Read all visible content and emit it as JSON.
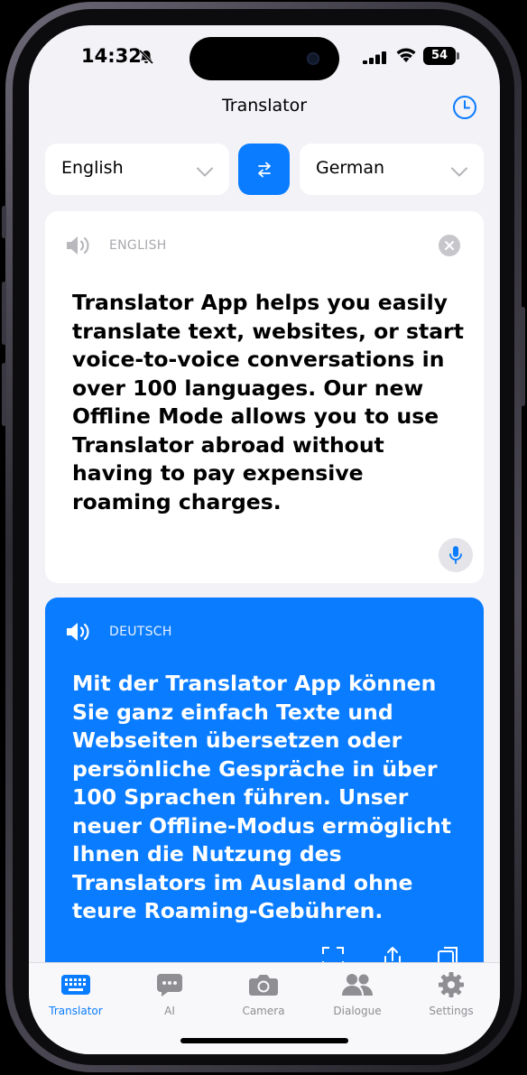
{
  "status_bar": {
    "time": "14:32",
    "battery": "54"
  },
  "header": {
    "title": "Translator"
  },
  "languages": {
    "source": "English",
    "target": "German"
  },
  "source_card": {
    "lang_tag": "ENGLISH",
    "text": "Translator App helps you easily translate text, websites, or start voice-to-voice conversations in over 100 languages. Our new Offline Mode allows you to use Translator abroad without having to pay expensive roaming charges."
  },
  "target_card": {
    "lang_tag": "DEUTSCH",
    "text": "Mit der Translator App können Sie ganz einfach Texte und Webseiten übersetzen oder persönliche Gespräche in über 100 Sprachen führen. Unser neuer Offline-Modus ermöglicht Ihnen die Nutzung des Translators im Ausland ohne teure Roaming-Gebühren."
  },
  "tabs": [
    {
      "label": "Translator",
      "icon": "keyboard-icon",
      "active": true
    },
    {
      "label": "AI",
      "icon": "chat-bubble-icon",
      "active": false
    },
    {
      "label": "Camera",
      "icon": "camera-icon",
      "active": false
    },
    {
      "label": "Dialogue",
      "icon": "people-icon",
      "active": false
    },
    {
      "label": "Settings",
      "icon": "gear-icon",
      "active": false
    }
  ],
  "colors": {
    "accent": "#0a7cff",
    "background": "#f2f2f7",
    "card": "#ffffff",
    "muted": "#8e8e93"
  }
}
